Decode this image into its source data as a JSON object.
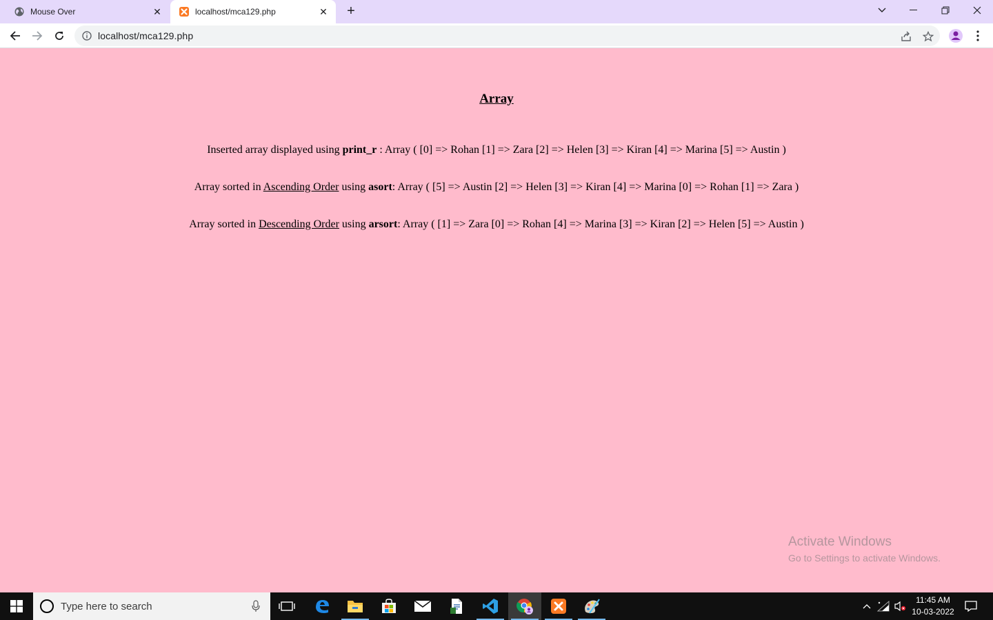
{
  "browser": {
    "tabs": [
      {
        "title": "Mouse Over",
        "icon": "globe-icon",
        "active": false
      },
      {
        "title": "localhost/mca129.php",
        "icon": "xampp-icon",
        "active": true
      }
    ],
    "address": "localhost/mca129.php"
  },
  "page": {
    "heading": "Array",
    "line1": {
      "prefix": "Inserted array displayed using ",
      "func": "print_r",
      "suffix": " : Array ( [0] => Rohan [1] => Zara [2] => Helen [3] => Kiran [4] => Marina [5] => Austin )"
    },
    "line2": {
      "prefix": "Array sorted in ",
      "order": "Ascending Order",
      "mid": " using ",
      "func": "asort",
      "suffix": ": Array ( [5] => Austin [2] => Helen [3] => Kiran [4] => Marina [0] => Rohan [1] => Zara )"
    },
    "line3": {
      "prefix": "Array sorted in ",
      "order": "Descending Order",
      "mid": " using ",
      "func": "arsort",
      "suffix": ": Array ( [1] => Zara [0] => Rohan [4] => Marina [3] => Kiran [2] => Helen [5] => Austin )"
    },
    "background": "#ffbbcc"
  },
  "watermark": {
    "line1": "Activate Windows",
    "line2": "Go to Settings to activate Windows."
  },
  "taskbar": {
    "search_placeholder": "Type here to search",
    "time": "11:45 AM",
    "date": "10-03-2022"
  }
}
